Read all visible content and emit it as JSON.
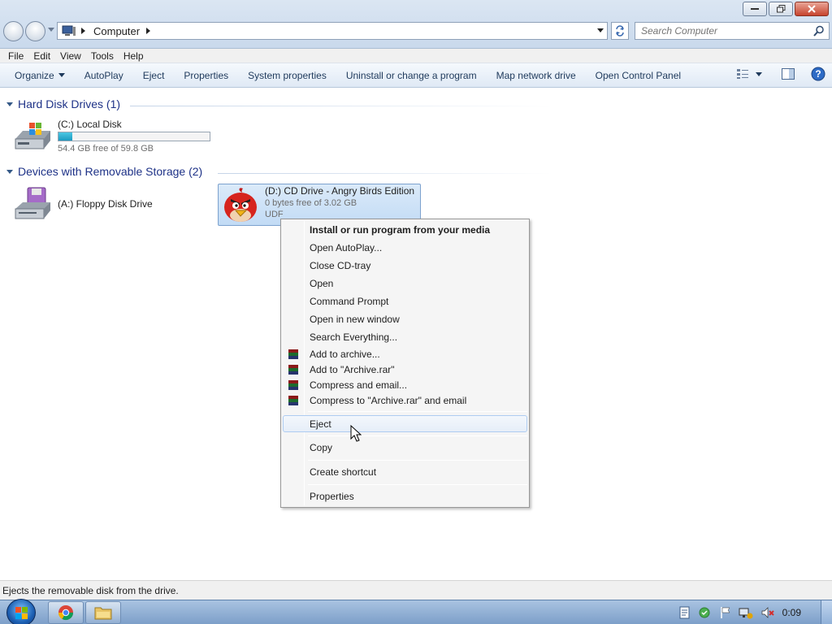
{
  "window": {
    "breadcrumb": "Computer",
    "search_placeholder": "Search Computer"
  },
  "menubar": [
    "File",
    "Edit",
    "View",
    "Tools",
    "Help"
  ],
  "toolbar": {
    "organize": "Organize",
    "items": [
      "AutoPlay",
      "Eject",
      "Properties",
      "System properties",
      "Uninstall or change a program",
      "Map network drive",
      "Open Control Panel"
    ]
  },
  "groups": {
    "hard_disk": {
      "title": "Hard Disk Drives (1)",
      "drives": [
        {
          "name": "(C:) Local Disk",
          "free": "54.4 GB free of 59.8 GB",
          "used_fraction": 0.09
        }
      ]
    },
    "removable": {
      "title": "Devices with Removable Storage (2)",
      "drives": [
        {
          "name": "(A:) Floppy Disk Drive"
        },
        {
          "name": "(D:) CD Drive - Angry Birds Edition",
          "free": "0 bytes free of 3.02 GB",
          "fs": "UDF"
        }
      ]
    }
  },
  "context_menu": {
    "items": [
      {
        "label": "Install or run program from your media",
        "bold": true
      },
      {
        "label": "Open AutoPlay..."
      },
      {
        "label": "Close CD-tray"
      },
      {
        "label": "Open"
      },
      {
        "label": "Command Prompt"
      },
      {
        "label": "Open in new window"
      },
      {
        "label": "Search Everything..."
      },
      {
        "label": "Add to archive...",
        "icon": "winrar-icon"
      },
      {
        "label": "Add to \"Archive.rar\"",
        "icon": "winrar-icon"
      },
      {
        "label": "Compress and email...",
        "icon": "winrar-icon"
      },
      {
        "label": "Compress to \"Archive.rar\" and email",
        "icon": "winrar-icon"
      },
      {
        "label": "Eject",
        "hover": true
      },
      {
        "label": "Copy"
      },
      {
        "label": "Create shortcut"
      },
      {
        "label": "Properties"
      }
    ]
  },
  "statusbar": {
    "text": "Ejects the removable disk from the drive."
  },
  "taskbar": {
    "clock": "0:09"
  }
}
